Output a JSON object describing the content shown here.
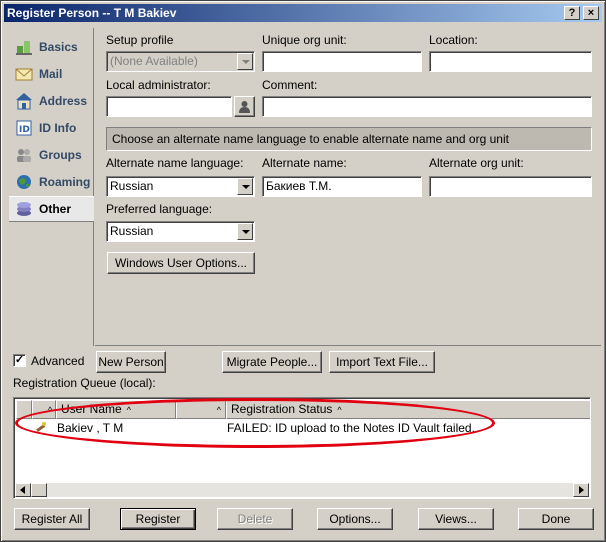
{
  "window": {
    "title": "Register Person -- T M Bakiev",
    "help_label": "?",
    "close_label": "×"
  },
  "sidebar": {
    "items": [
      {
        "label": "Basics",
        "icon": "basics-icon"
      },
      {
        "label": "Mail",
        "icon": "mail-icon"
      },
      {
        "label": "Address",
        "icon": "address-icon"
      },
      {
        "label": "ID Info",
        "icon": "id-info-icon"
      },
      {
        "label": "Groups",
        "icon": "groups-icon"
      },
      {
        "label": "Roaming",
        "icon": "roaming-icon"
      },
      {
        "label": "Other",
        "icon": "other-icon",
        "active": true
      }
    ]
  },
  "form": {
    "setup_profile_label": "Setup profile",
    "setup_profile_value": "(None Available)",
    "unique_org_unit_label": "Unique org unit:",
    "unique_org_unit_value": "",
    "location_label": "Location:",
    "location_value": "",
    "local_admin_label": "Local administrator:",
    "local_admin_value": "",
    "comment_label": "Comment:",
    "comment_value": "",
    "info_text": "Choose an alternate name language to enable alternate name and org unit",
    "alt_lang_label": "Alternate name language:",
    "alt_lang_value": "Russian",
    "alt_name_label": "Alternate name:",
    "alt_name_value": "Бакиев Т.М.",
    "alt_org_label": "Alternate org unit:",
    "alt_org_value": "",
    "pref_lang_label": "Preferred language:",
    "pref_lang_value": "Russian",
    "windows_user_options_label": "Windows User Options..."
  },
  "middle": {
    "advanced_label": "Advanced",
    "advanced_checked": true,
    "new_person_label": "New Person",
    "migrate_people_label": "Migrate People...",
    "import_text_label": "Import Text File...",
    "queue_label": "Registration Queue (local):"
  },
  "queue": {
    "columns": [
      "User Name",
      "",
      "Registration Status"
    ],
    "rows": [
      {
        "user": "Bakiev , T M",
        "status": "FAILED:  ID upload to the Notes ID Vault failed."
      }
    ]
  },
  "footer": {
    "register_all_label": "Register All",
    "register_label": "Register",
    "delete_label": "Delete",
    "options_label": "Options...",
    "views_label": "Views...",
    "done_label": "Done"
  },
  "colors": {
    "title_gradient_start": "#0a246a",
    "highlight_annotation": "#e00010"
  }
}
